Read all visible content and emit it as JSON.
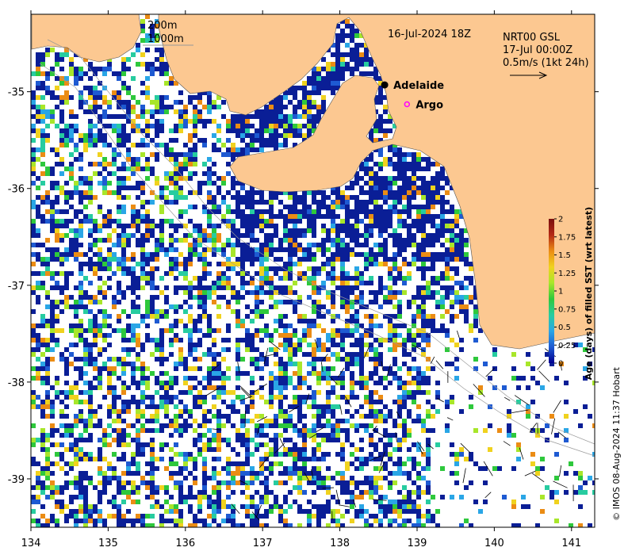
{
  "map": {
    "date_label": "16-Jul-2024 18Z",
    "product_line1": "NRT00 GSL",
    "product_line2": "17-Jul 00:00Z",
    "scale_label": "0.5m/s (1kt 24h)",
    "isobath_label1": "200m",
    "isobath_label2": "1000m",
    "places": [
      {
        "name": "Adelaide",
        "lon": 138.58,
        "lat": -34.93,
        "marker": "filled-circle"
      },
      {
        "name": "Argo",
        "lon": 138.87,
        "lat": -35.13,
        "marker": "open-circle"
      }
    ],
    "credit": "© IMOS 08-Aug-2024 11:37 Hobart",
    "colors": {
      "land": "#fcc891",
      "ocean_young": "#0a1e96",
      "ocean_gap": "#ffffff"
    }
  },
  "axes": {
    "lon_ticks": [
      "134",
      "135",
      "136",
      "137",
      "138",
      "139",
      "140",
      "141"
    ],
    "lat_ticks": [
      "-35",
      "-36",
      "-37",
      "-38",
      "-39"
    ],
    "lon_range": [
      134,
      141.3
    ],
    "lat_range": [
      -39.5,
      -34.2
    ]
  },
  "colorbar": {
    "title": "Age (days) of filled SST (wrt latest)",
    "ticks": [
      "0",
      "0.25",
      "0.5",
      "0.75",
      "1",
      "1.25",
      "1.5",
      "1.75",
      "2"
    ],
    "range": [
      0,
      2
    ],
    "colors": [
      "#00008f",
      "#1e5ad2",
      "#2aa6e6",
      "#27cca0",
      "#2ec83c",
      "#a8e62a",
      "#f0d21e",
      "#eb8c14",
      "#b42814",
      "#7a0f0f"
    ]
  },
  "chart_data": {
    "type": "heatmap",
    "title": "",
    "xlabel": "",
    "ylabel": "",
    "xlim": [
      134,
      141.3
    ],
    "ylim": [
      -39.5,
      -34.2
    ],
    "colorbar_label": "Age (days) of filled SST (wrt latest)",
    "colorbar_range": [
      0,
      2
    ]
  }
}
